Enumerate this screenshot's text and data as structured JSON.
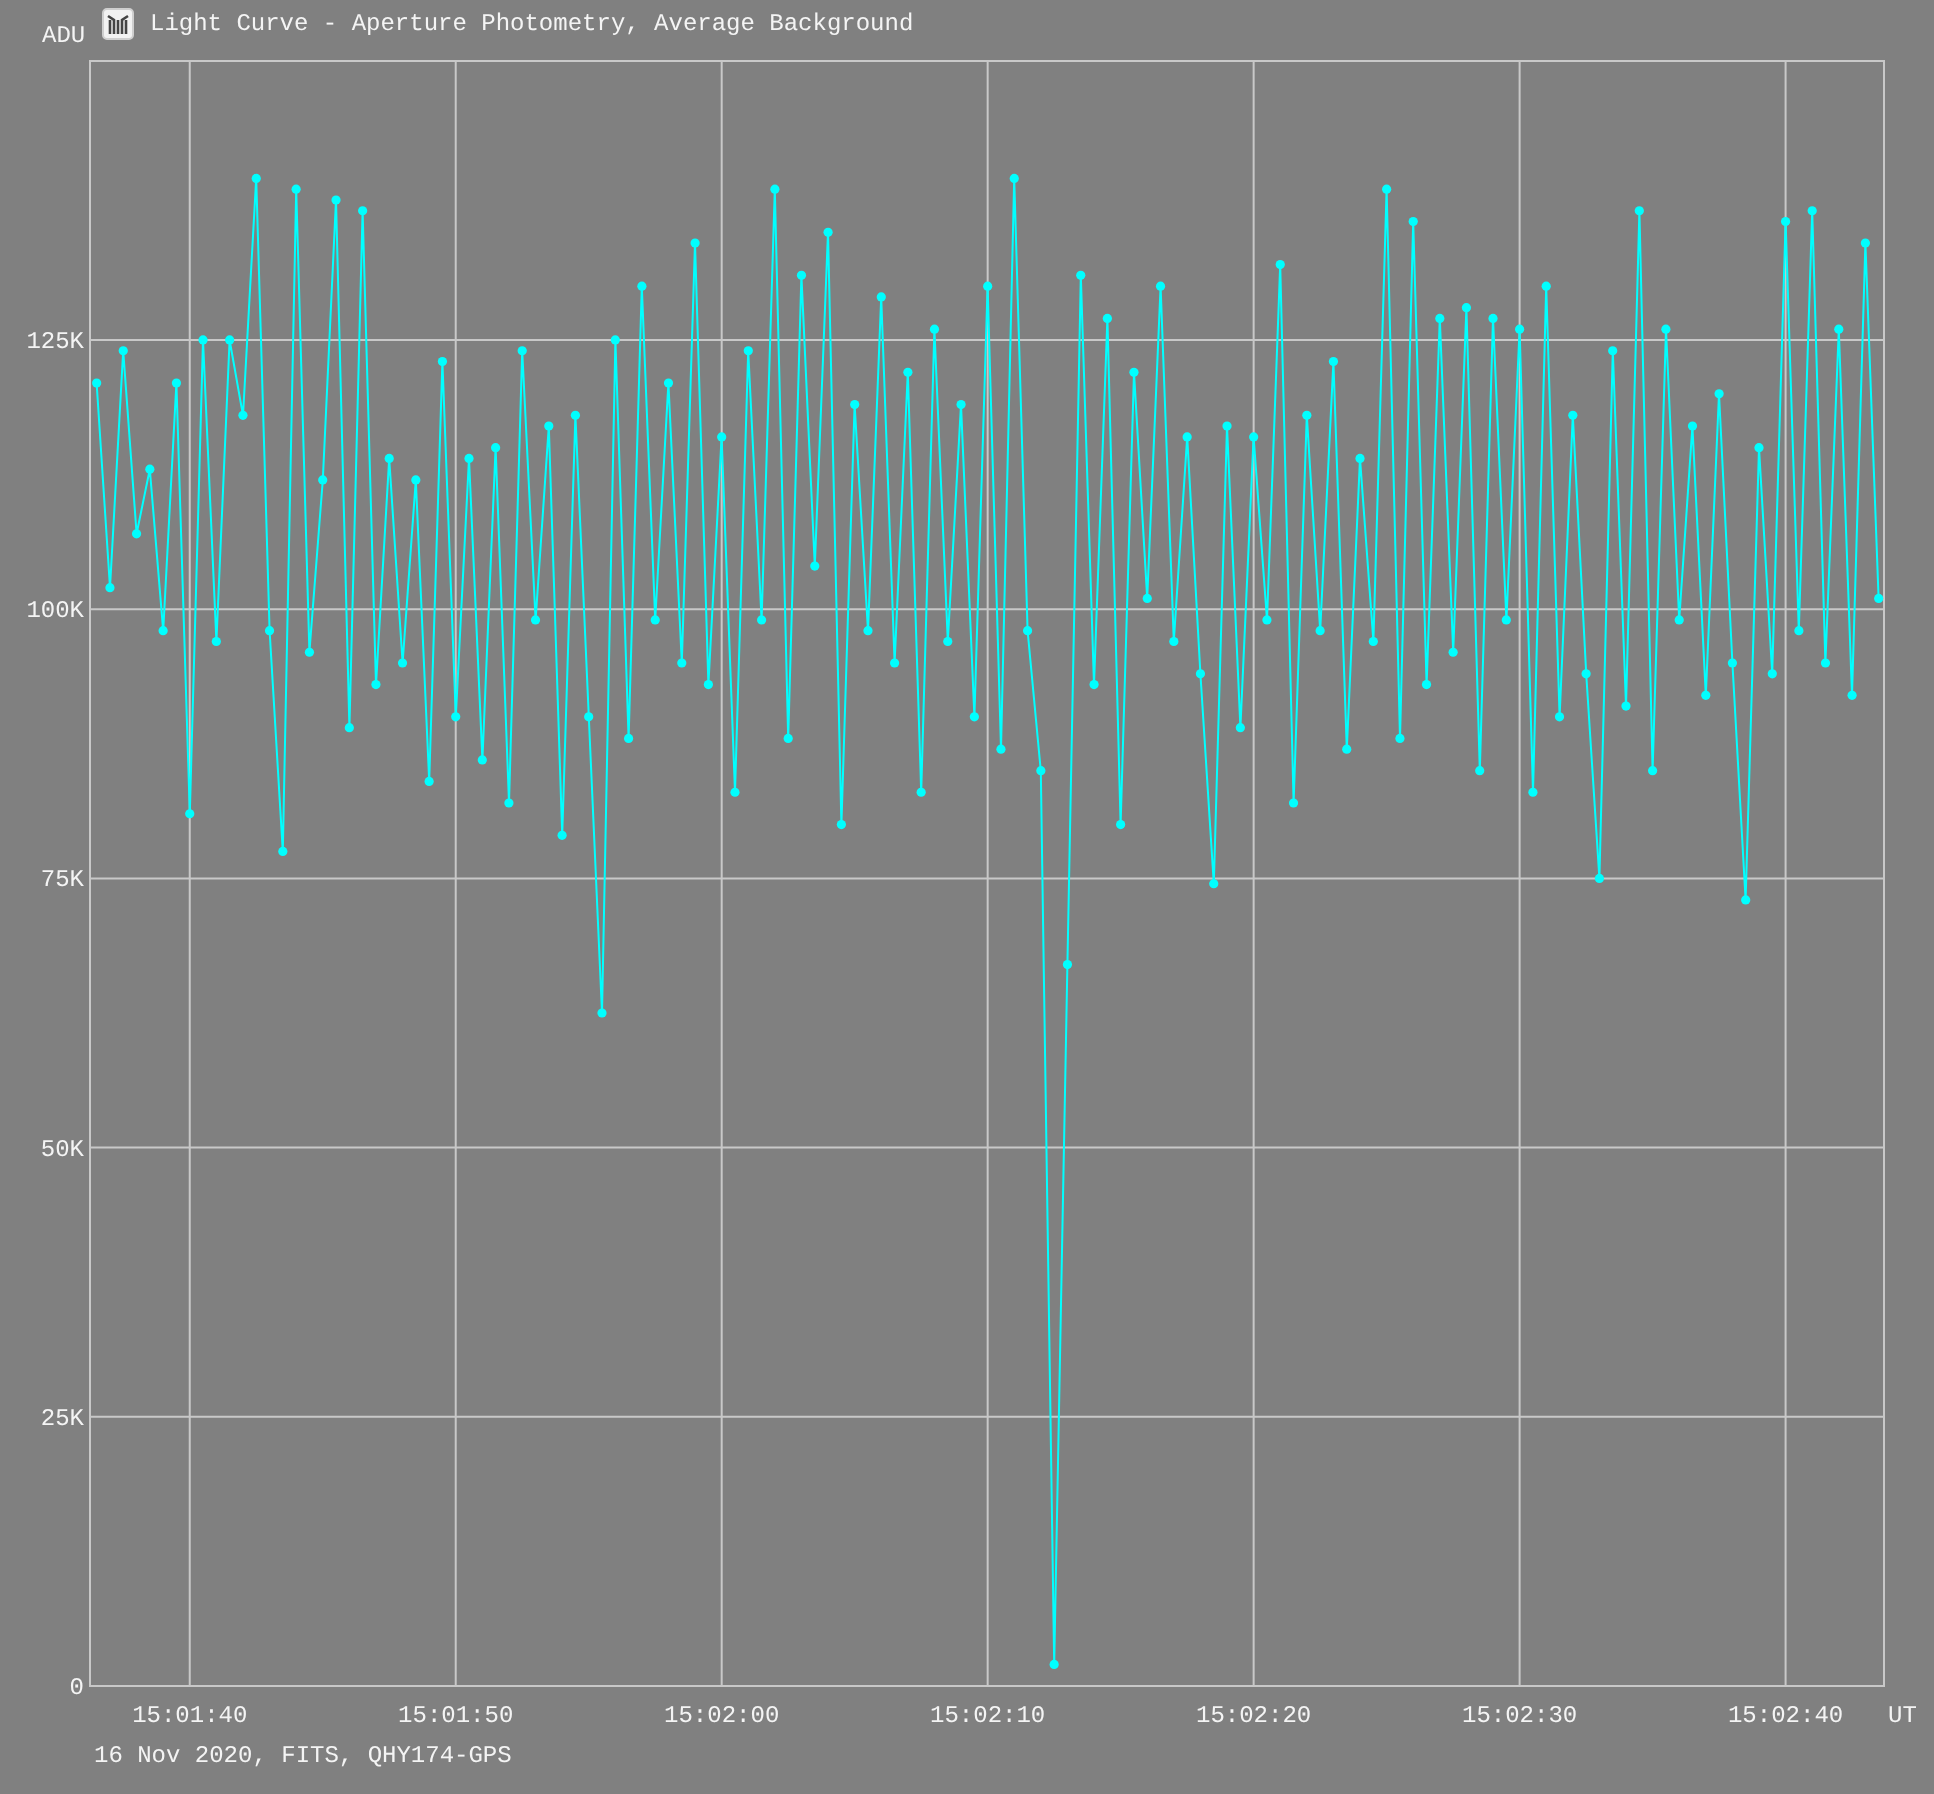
{
  "window": {
    "title": "Light Curve - Aperture Photometry, Average Background"
  },
  "chart": {
    "chart_data": {
      "type": "line",
      "grid": true,
      "ylabel": "ADU",
      "xlabel": "UT",
      "xlim": [
        54096.25,
        54163.7
      ],
      "ylim": [
        0,
        151
      ],
      "xticks": [
        {
          "value": 54100,
          "label": "15:01:40"
        },
        {
          "value": 54110,
          "label": "15:01:50"
        },
        {
          "value": 54120,
          "label": "15:02:00"
        },
        {
          "value": 54130,
          "label": "15:02:10"
        },
        {
          "value": 54140,
          "label": "15:02:20"
        },
        {
          "value": 54150,
          "label": "15:02:30"
        },
        {
          "value": 54160,
          "label": "15:02:40"
        }
      ],
      "yticks": [
        {
          "value": 0,
          "label": "0"
        },
        {
          "value": 25,
          "label": "25K"
        },
        {
          "value": 50,
          "label": "50K"
        },
        {
          "value": 75,
          "label": "75K"
        },
        {
          "value": 100,
          "label": "100K"
        },
        {
          "value": 125,
          "label": "125K"
        }
      ],
      "x": [
        54096.5,
        54097,
        54097.5,
        54098,
        54098.5,
        54099,
        54099.5,
        54100,
        54100.5,
        54101,
        54101.5,
        54102,
        54102.5,
        54103,
        54103.5,
        54104,
        54104.5,
        54105,
        54105.5,
        54106,
        54106.5,
        54107,
        54107.5,
        54108,
        54108.5,
        54109,
        54109.5,
        54110,
        54110.5,
        54111,
        54111.5,
        54112,
        54112.5,
        54113,
        54113.5,
        54114,
        54114.5,
        54115,
        54115.5,
        54116,
        54116.5,
        54117,
        54117.5,
        54118,
        54118.5,
        54119,
        54119.5,
        54120,
        54120.5,
        54121,
        54121.5,
        54122,
        54122.5,
        54123,
        54123.5,
        54124,
        54124.5,
        54125,
        54125.5,
        54126,
        54126.5,
        54127,
        54127.5,
        54128,
        54128.5,
        54129,
        54129.5,
        54130,
        54130.5,
        54131,
        54131.5,
        54132,
        54132.5,
        54133,
        54133.5,
        54134,
        54134.5,
        54135,
        54135.5,
        54136,
        54136.5,
        54137,
        54137.5,
        54138,
        54138.5,
        54139,
        54139.5,
        54140,
        54140.5,
        54141,
        54141.5,
        54142,
        54142.5,
        54143,
        54143.5,
        54144,
        54144.5,
        54145,
        54145.5,
        54146,
        54146.5,
        54147,
        54147.5,
        54148,
        54148.5,
        54149,
        54149.5,
        54150,
        54150.5,
        54151,
        54151.5,
        54152,
        54152.5,
        54153,
        54153.5,
        54154,
        54154.5,
        54155,
        54155.5,
        54156,
        54156.5,
        54157,
        54157.5,
        54158,
        54158.5,
        54159,
        54159.5,
        54160,
        54160.5,
        54161,
        54161.5,
        54162,
        54162.5,
        54163,
        54163.5
      ],
      "series": [
        {
          "color": "#00ffff",
          "marker": "circle",
          "values": [
            121,
            102,
            124,
            107,
            113,
            98,
            121,
            81,
            125,
            97,
            125,
            118,
            140,
            98,
            77.5,
            139,
            96,
            112,
            138,
            89,
            137,
            93,
            114,
            95,
            112,
            84,
            123,
            90,
            114,
            86,
            115,
            82,
            124,
            99,
            117,
            79,
            118,
            90,
            62.5,
            125,
            88,
            130,
            99,
            121,
            95,
            134,
            93,
            116,
            83,
            124,
            99,
            139,
            88,
            131,
            104,
            135,
            80,
            119,
            98,
            129,
            95,
            122,
            83,
            126,
            97,
            119,
            90,
            130,
            87,
            140,
            98,
            85,
            2,
            67,
            131,
            93,
            127,
            80,
            122,
            101,
            130,
            97,
            116,
            94,
            74.5,
            117,
            89,
            116,
            99,
            132,
            82,
            118,
            98,
            123,
            87,
            114,
            97,
            139,
            88,
            136,
            93,
            127,
            96,
            128,
            85,
            127,
            99,
            126,
            83,
            130,
            90,
            118,
            94,
            75,
            124,
            91,
            137,
            85,
            126,
            99,
            117,
            92,
            120,
            95,
            73,
            115,
            94,
            136,
            98,
            137,
            95,
            126,
            92,
            134,
            101
          ]
        }
      ]
    }
  },
  "footer": "16 Nov 2020, FITS, QHY174-GPS"
}
